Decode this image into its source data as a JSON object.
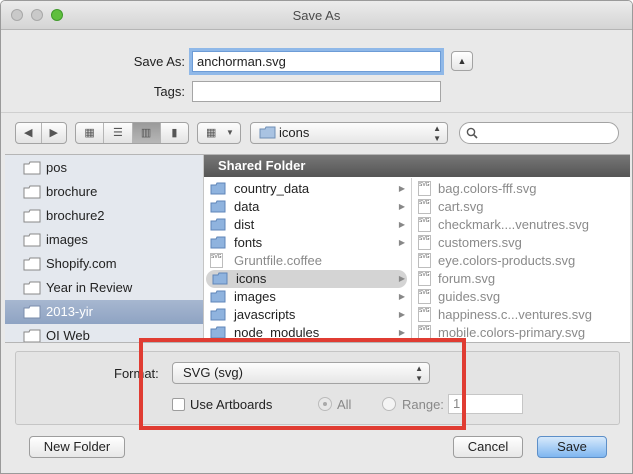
{
  "window": {
    "title": "Save As"
  },
  "save_as": {
    "label": "Save As:",
    "value": "anchorman.svg"
  },
  "tags": {
    "label": "Tags:",
    "value": ""
  },
  "toolbar": {
    "location": "icons"
  },
  "sidebar": {
    "items": [
      {
        "label": "pos"
      },
      {
        "label": "brochure"
      },
      {
        "label": "brochure2"
      },
      {
        "label": "images"
      },
      {
        "label": "Shopify.com"
      },
      {
        "label": "Year in Review"
      },
      {
        "label": "2013-yir"
      },
      {
        "label": "OI Web"
      }
    ]
  },
  "column_header": "Shared Folder",
  "column1": {
    "items": [
      {
        "label": "country_data"
      },
      {
        "label": "data"
      },
      {
        "label": "dist"
      },
      {
        "label": "fonts"
      },
      {
        "label": "Gruntfile.coffee"
      },
      {
        "label": "icons"
      },
      {
        "label": "images"
      },
      {
        "label": "javascripts"
      },
      {
        "label": "node_modules"
      }
    ]
  },
  "column2": {
    "items": [
      {
        "label": "bag.colors-fff.svg"
      },
      {
        "label": "cart.svg"
      },
      {
        "label": "checkmark....venutres.svg"
      },
      {
        "label": "customers.svg"
      },
      {
        "label": "eye.colors-products.svg"
      },
      {
        "label": "forum.svg"
      },
      {
        "label": "guides.svg"
      },
      {
        "label": "happiness.c...ventures.svg"
      },
      {
        "label": "mobile.colors-primary.svg"
      }
    ]
  },
  "options": {
    "format_label": "Format:",
    "format_value": "SVG (svg)",
    "use_artboards": "Use Artboards",
    "all_label": "All",
    "range_label": "Range:",
    "range_value": "1"
  },
  "buttons": {
    "new_folder": "New Folder",
    "cancel": "Cancel",
    "save": "Save"
  },
  "colors": {
    "highlight": "#e03c32",
    "default_button": "#7fb6f0",
    "sidebar_selection": "#8ea3c3"
  },
  "icons": [
    "folder-icon",
    "search-icon",
    "svg-file-icon",
    "chevron-right-icon",
    "collapse-icon"
  ]
}
